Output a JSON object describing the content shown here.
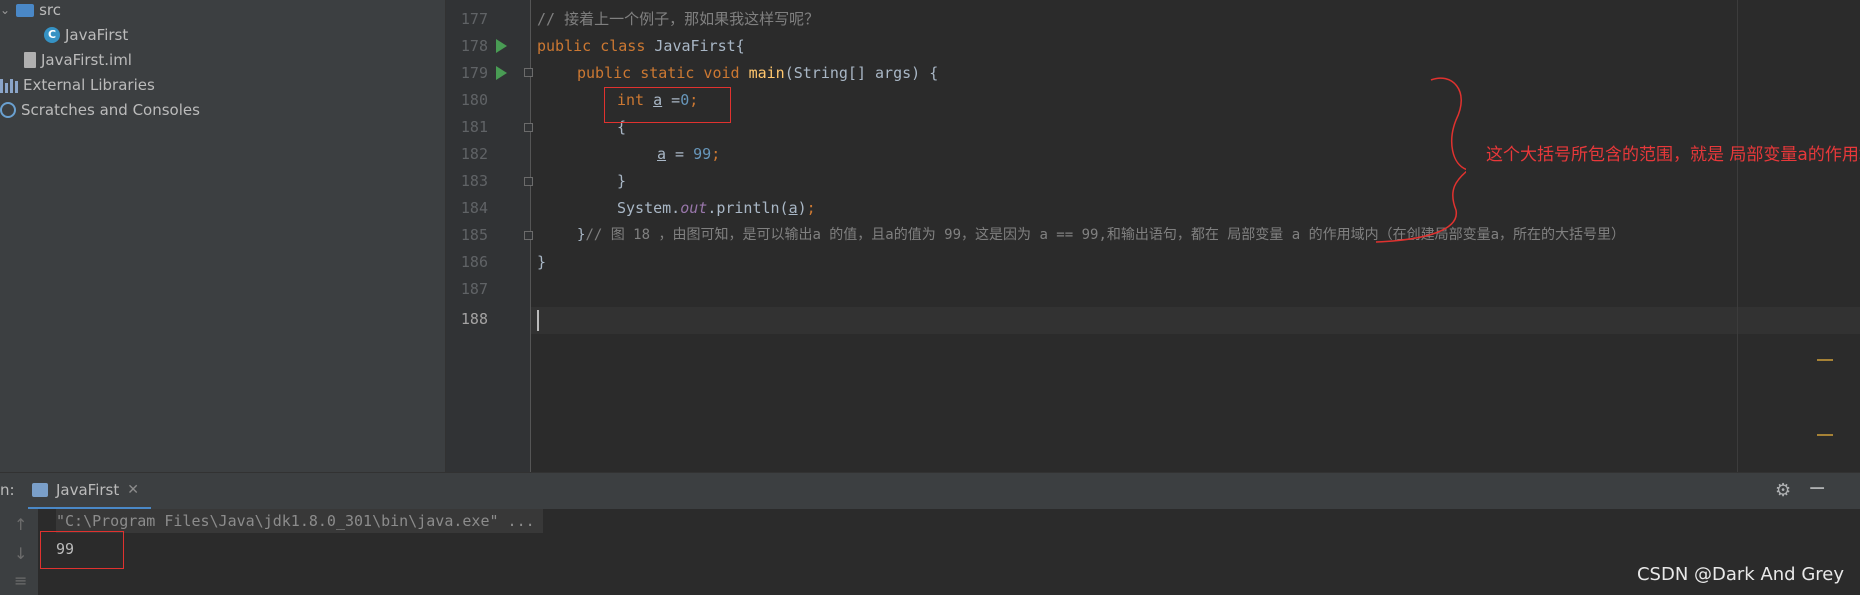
{
  "project_tree": {
    "items": [
      {
        "label": "src",
        "icon": "folder-icon"
      },
      {
        "label": "JavaFirst",
        "icon": "java-class-icon"
      },
      {
        "label": "JavaFirst.iml",
        "icon": "iml-file-icon"
      },
      {
        "label": "External Libraries",
        "icon": "libraries-icon"
      },
      {
        "label": "Scratches and Consoles",
        "icon": "scratches-icon"
      }
    ]
  },
  "editor": {
    "line_numbers": [
      "177",
      "178",
      "179",
      "180",
      "181",
      "182",
      "183",
      "184",
      "185",
      "186",
      "187",
      "188"
    ],
    "current_line": "188",
    "code": {
      "l177": "// 接着上一个例子，那如果我这样写呢？",
      "l178_kw": "public class ",
      "l178_rest": "JavaFirst{",
      "l179_kw": "public static void ",
      "l179_fn": "main",
      "l179_rest": "(String[] args) {",
      "l180_kw": "int ",
      "l180_var": "a",
      "l180_op": " =",
      "l180_num": "0",
      "l180_end": ";",
      "l181": "{",
      "l182_var": "a",
      "l182_op": " = ",
      "l182_num": "99",
      "l182_end": ";",
      "l183": "}",
      "l184_a": "System.",
      "l184_fld": "out",
      "l184_b": ".println(",
      "l184_var": "a",
      "l184_c": ")",
      "l184_end": ";",
      "l185_brace": "}",
      "l185_cm": "// 图 18 ，由图可知，是可以输出a 的值，且a的值为 99，这是因为 a == 99,和输出语句，都在 局部变量 a 的作用域内（在创建局部变量a，所在的大括号里）",
      "l186": "}"
    }
  },
  "annotation": {
    "text": "这个大括号所包含的范围，就是 局部变量a的作用域",
    "color": "#e8383a"
  },
  "run_panel": {
    "prefix": "n:",
    "tab_label": "JavaFirst",
    "command": "\"C:\\Program Files\\Java\\jdk1.8.0_301\\bin\\java.exe\" ...",
    "output": "99"
  },
  "watermark": "CSDN @Dark And Grey"
}
